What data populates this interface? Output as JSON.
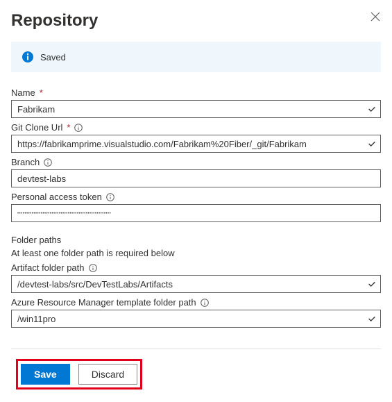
{
  "header": {
    "title": "Repository"
  },
  "banner": {
    "message": "Saved"
  },
  "fields": {
    "name": {
      "label": "Name",
      "value": "Fabrikam"
    },
    "giturl": {
      "label": "Git Clone Url",
      "value": "https://fabrikamprime.visualstudio.com/Fabrikam%20Fiber/_git/Fabrikam"
    },
    "branch": {
      "label": "Branch",
      "value": "devtest-labs"
    },
    "pat": {
      "label": "Personal access token",
      "value": "••••••••••••••••••••••••••••••••••••••••••••••••••••"
    }
  },
  "folders": {
    "title": "Folder paths",
    "hint": "At least one folder path is required below",
    "artifact": {
      "label": "Artifact folder path",
      "value": "/devtest-labs/src/DevTestLabs/Artifacts"
    },
    "arm": {
      "label": "Azure Resource Manager template folder path",
      "value": "/win11pro"
    }
  },
  "actions": {
    "save": "Save",
    "discard": "Discard"
  }
}
